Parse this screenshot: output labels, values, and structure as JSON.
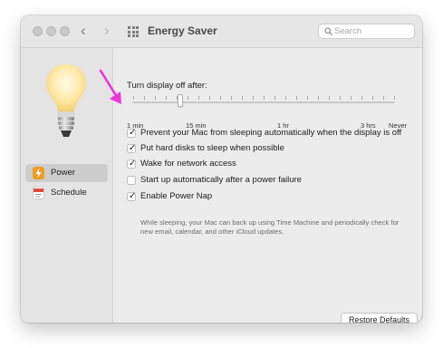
{
  "window": {
    "title": "Energy Saver"
  },
  "search": {
    "placeholder": "Search"
  },
  "sidebar": {
    "items": [
      {
        "label": "Power",
        "icon": "lightning-icon",
        "selected": true,
        "color": "#f29b22"
      },
      {
        "label": "Schedule",
        "icon": "calendar-icon",
        "selected": false,
        "color": "#e04a3f"
      }
    ]
  },
  "display_off": {
    "label": "Turn display off after:",
    "ticks": [
      "1 min",
      "15 min",
      "1 hr",
      "3 hrs",
      "Never"
    ],
    "value": "15 min"
  },
  "options": [
    {
      "label": "Prevent your Mac from sleeping automatically when the display is off",
      "checked": true
    },
    {
      "label": "Put hard disks to sleep when possible",
      "checked": true
    },
    {
      "label": "Wake for network access",
      "checked": true
    },
    {
      "label": "Start up automatically after a power failure",
      "checked": false
    },
    {
      "label": "Enable Power Nap",
      "checked": true
    }
  ],
  "power_nap_description": "While sleeping, your Mac can back up using Time Machine and periodically check for new email, calendar, and other iCloud updates.",
  "footer": {
    "restore_label": "Restore Defaults",
    "help_label": "?"
  },
  "colors": {
    "annotation_arrow": "#e838d8",
    "accent": "#f29b22"
  }
}
